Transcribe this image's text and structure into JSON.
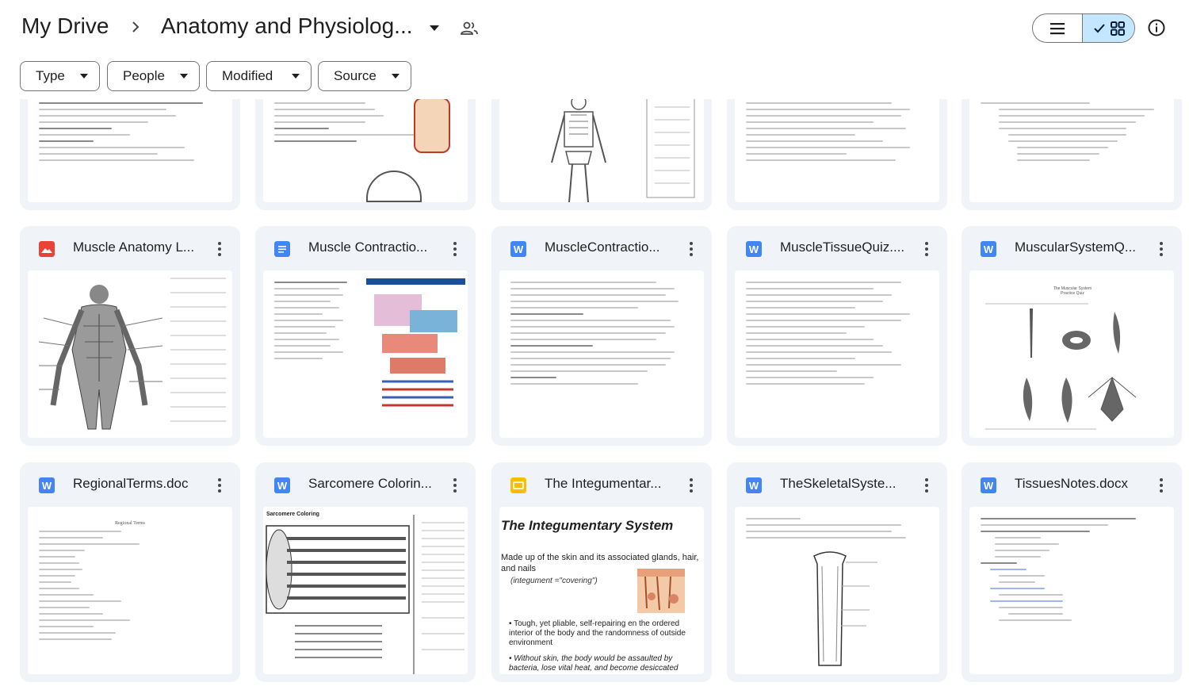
{
  "header": {
    "root": "My Drive",
    "current_folder": "Anatomy and Physiolog..."
  },
  "filters": [
    "Type",
    "People",
    "Modified",
    "Source"
  ],
  "files": [
    {
      "name": "Muscle Anatomy L...",
      "icon": "image-file-icon",
      "icon_color": "#ea4335",
      "icon_char": ""
    },
    {
      "name": "Muscle Contractio...",
      "icon": "google-docs-icon",
      "icon_color": "#4285f4",
      "icon_char": "≡"
    },
    {
      "name": "MuscleContractio...",
      "icon": "word-doc-icon",
      "icon_color": "#4285f4",
      "icon_char": "W"
    },
    {
      "name": "MuscleTissueQuiz....",
      "icon": "word-doc-icon",
      "icon_color": "#4285f4",
      "icon_char": "W"
    },
    {
      "name": "MuscularSystemQ...",
      "icon": "word-doc-icon",
      "icon_color": "#4285f4",
      "icon_char": "W"
    },
    {
      "name": "RegionalTerms.doc",
      "icon": "word-doc-icon",
      "icon_color": "#4285f4",
      "icon_char": "W"
    },
    {
      "name": "Sarcomere Colorin...",
      "icon": "word-doc-icon",
      "icon_color": "#4285f4",
      "icon_char": "W"
    },
    {
      "name": "The Integumentar...",
      "icon": "google-slides-icon",
      "icon_color": "#fbbc04",
      "icon_char": "▭"
    },
    {
      "name": "TheSkeletalSyste...",
      "icon": "word-doc-icon",
      "icon_color": "#4285f4",
      "icon_char": "W"
    },
    {
      "name": "TissuesNotes.docx",
      "icon": "word-doc-icon",
      "icon_color": "#4285f4",
      "icon_char": "W"
    }
  ],
  "previews": {
    "integumentary_title": "The Integumentary System",
    "integumentary_line1": "Made up of the skin and its associated glands, hair, and nails",
    "integumentary_line2": "(integument =\"covering\")",
    "integumentary_bullet1": "• Tough, yet pliable, self-repairing           en the ordered interior of the body and the randomness of outside environment",
    "integumentary_bullet2": "• Without skin, the body would be assaulted by bacteria, lose vital heat, and become desiccated",
    "sarcomere_title": "Sarcomere Coloring",
    "regional_title": "Regional Terms",
    "muscular_title": "The Muscular System Practice Quiz"
  },
  "colors": {
    "card_bg": "#f0f4f9",
    "selected_toggle": "#c2e7ff",
    "border": "#747775"
  }
}
